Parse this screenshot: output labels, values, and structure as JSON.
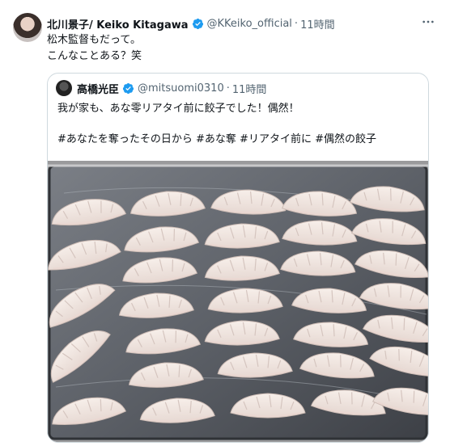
{
  "tweet": {
    "author_name": "北川景子/ Keiko Kitagawa",
    "handle": "@KKeiko_official",
    "separator": "·",
    "time": "11時間",
    "text_lines": [
      "松木監督もだって。",
      "こんなことある？笑"
    ],
    "more_icon": "more-icon"
  },
  "quote": {
    "author_name": "高橋光臣",
    "handle": "@mitsuomi0310",
    "separator": "·",
    "time": "11時間",
    "text_line1": "我が家も、あな零リアタイ前に餃子でした！偶然！",
    "text_line2": "#あなたを奪ったその日から #あな奪 #リアタイ前に #偶然の餃子"
  },
  "colors": {
    "verified": "#1d9bf0",
    "text": "#0f1419",
    "secondary": "#536471",
    "border": "#cfd9de"
  }
}
